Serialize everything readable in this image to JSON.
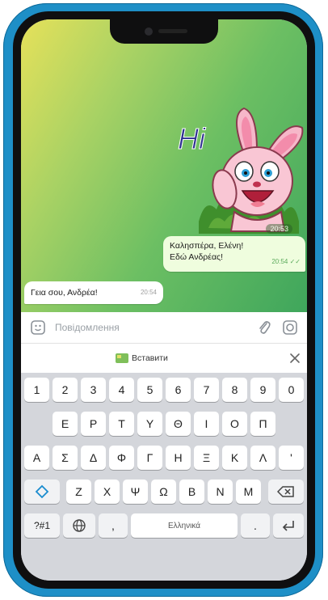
{
  "chat": {
    "sticker": {
      "text": "Hi",
      "time": "20:53"
    },
    "outgoing": {
      "line1": "Καλησπέρα, Ελένη!",
      "line2": "Εδώ Ανδρέας!",
      "time": "20:54"
    },
    "incoming": {
      "text": "Γεια σου, Ανδρέα!",
      "time": "20:54"
    }
  },
  "input": {
    "placeholder": "Повідомлення"
  },
  "paste": {
    "label": "Вставити"
  },
  "keyboard": {
    "row1": [
      "1",
      "2",
      "3",
      "4",
      "5",
      "6",
      "7",
      "8",
      "9",
      "0"
    ],
    "row2": [
      "Ε",
      "Ρ",
      "Τ",
      "Υ",
      "Θ",
      "Ι",
      "Ο",
      "Π"
    ],
    "row3": [
      "Α",
      "Σ",
      "Δ",
      "Φ",
      "Γ",
      "Η",
      "Ξ",
      "Κ",
      "Λ",
      "'"
    ],
    "row4": [
      "Ζ",
      "Χ",
      "Ψ",
      "Ω",
      "Β",
      "Ν",
      "Μ"
    ],
    "row5": {
      "symbols": "?#1",
      "comma": ",",
      "space": "Ελληνικά",
      "period": "."
    }
  },
  "colors": {
    "phone": "#1e8fc7",
    "outgoing_bubble": "#effdde",
    "keyboard_bg": "#d4d6db"
  }
}
